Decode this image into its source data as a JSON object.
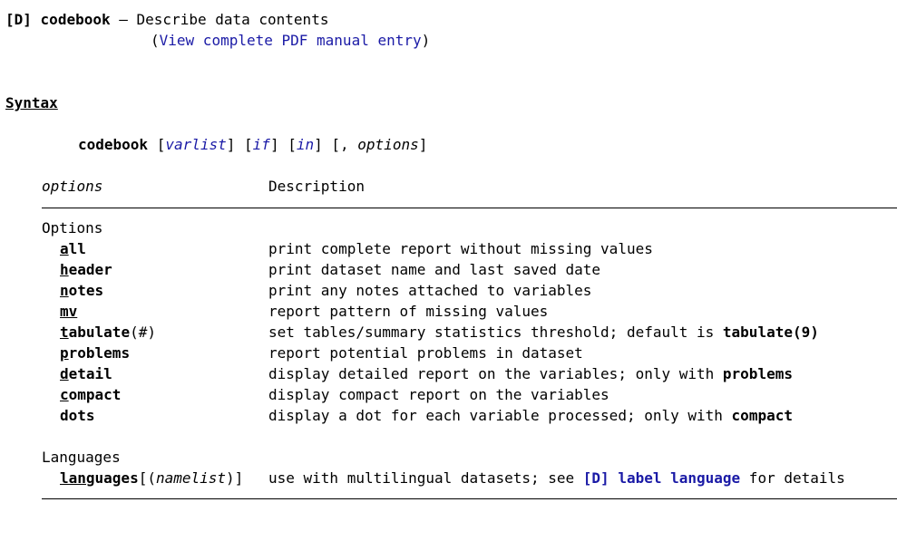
{
  "header": {
    "tag": "[D]",
    "command": "codebook",
    "dash": "—",
    "title": "Describe data contents",
    "manual_open": "(",
    "manual_link": "View complete PDF manual entry",
    "manual_close": ")"
  },
  "syntax": {
    "heading": "Syntax",
    "command": "codebook",
    "varlist": "varlist",
    "if": "if",
    "in": "in",
    "options": "options"
  },
  "table": {
    "col_options": "options",
    "col_description": "Description",
    "group_options": "Options",
    "rows": [
      {
        "abbr": "a",
        "rest": "ll",
        "arg": "",
        "desc": "print complete report without missing values"
      },
      {
        "abbr": "h",
        "rest": "eader",
        "arg": "",
        "desc": "print dataset name and last saved date"
      },
      {
        "abbr": "n",
        "rest": "otes",
        "arg": "",
        "desc": "print any notes attached to variables"
      },
      {
        "abbr": "mv",
        "rest": "",
        "arg": "",
        "desc": "report pattern of missing values"
      },
      {
        "abbr": "t",
        "rest": "abulate",
        "arg": "(#)",
        "desc": "set tables/summary statistics threshold; default is ",
        "desc_bold": "tabulate(9)"
      },
      {
        "abbr": "p",
        "rest": "roblems",
        "arg": "",
        "desc": "report potential problems in dataset"
      },
      {
        "abbr": "d",
        "rest": "etail",
        "arg": "",
        "desc": "display detailed report on the variables; only with ",
        "desc_bold": "problems"
      },
      {
        "abbr": "c",
        "rest": "ompact",
        "arg": "",
        "desc": "display compact report on the variables"
      },
      {
        "abbr": "",
        "rest": "dots",
        "arg": "",
        "desc": "display a dot for each variable processed; only with ",
        "desc_bold": "compact"
      }
    ],
    "group_languages": "Languages",
    "lang_abbr": "lang",
    "lang_rest": "uages",
    "lang_arg_open": "[(",
    "lang_arg": "namelist",
    "lang_arg_close": ")]",
    "lang_desc_pre": "use with multilingual datasets; see ",
    "lang_desc_link": "[D] label language",
    "lang_desc_post": " for details"
  }
}
